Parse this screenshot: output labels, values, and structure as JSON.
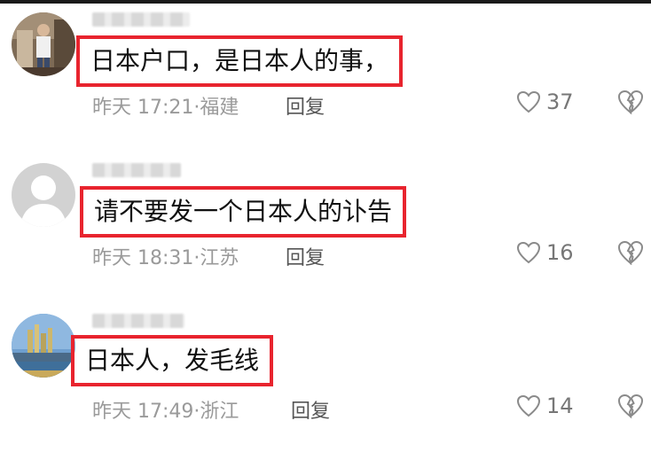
{
  "comments": [
    {
      "text": "日本户口，是日本人的事，",
      "time": "昨天 17:21",
      "location": "福建",
      "reply": "回复",
      "likes": "37",
      "avatar": "photo-person"
    },
    {
      "text": "请不要发一个日本人的讣告",
      "time": "昨天 18:31",
      "location": "江苏",
      "reply": "回复",
      "likes": "16",
      "avatar": "default-avatar"
    },
    {
      "text": "日本人，发毛线",
      "time": "昨天 17:49",
      "location": "浙江",
      "reply": "回复",
      "likes": "14",
      "avatar": "photo-city"
    }
  ],
  "colors": {
    "highlight": "#e8242e",
    "meta": "#9a9a9a"
  },
  "icons": {
    "like": "heart-outline-icon",
    "dislike": "broken-heart-icon"
  }
}
